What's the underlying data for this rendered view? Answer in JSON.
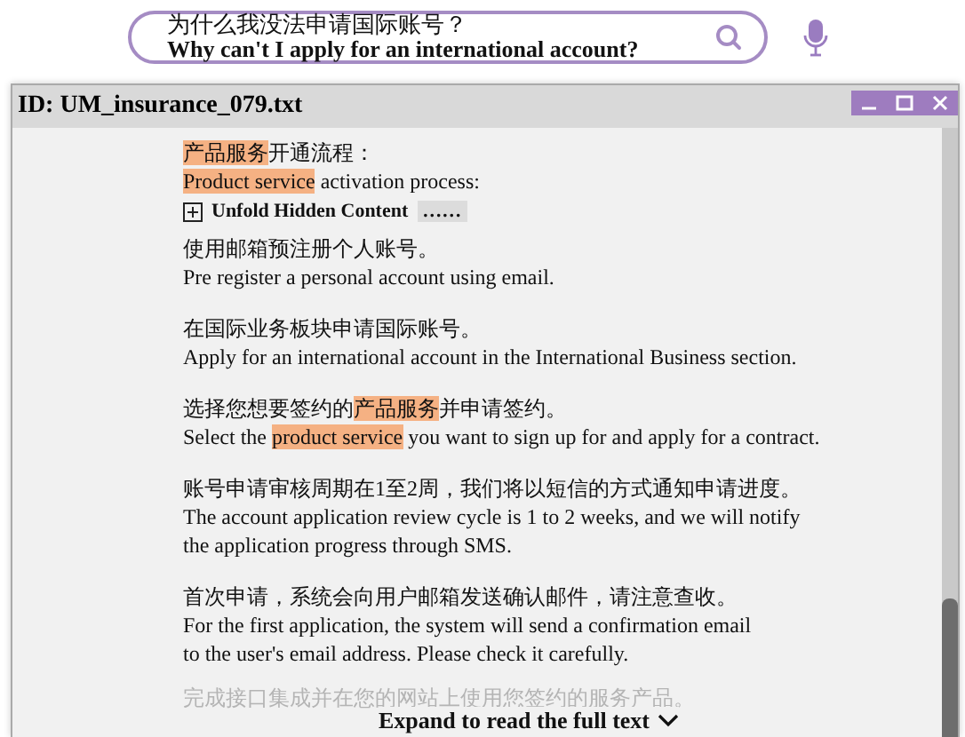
{
  "search": {
    "lines": [
      "为什么我没法申请国际账号？",
      "Why can't I apply for an international account?"
    ]
  },
  "window": {
    "title": "ID: UM_insurance_079.txt"
  },
  "heading": [
    [
      {
        "text": "产品服务",
        "highlighted": true
      },
      {
        "text": "开通流程：",
        "highlighted": false
      }
    ],
    [
      {
        "text": "Product service",
        "highlighted": true
      },
      {
        "text": " activation process:",
        "highlighted": false
      }
    ]
  ],
  "fold": {
    "label": "Unfold Hidden Content",
    "ellipsis": "……"
  },
  "paragraphs": [
    {
      "lines": [
        [
          {
            "text": "使用邮箱预注册个人账号。",
            "highlighted": false
          }
        ],
        [
          {
            "text": "Pre register a personal account using email.",
            "highlighted": false
          }
        ]
      ]
    },
    {
      "lines": [
        [
          {
            "text": "在国际业务板块申请国际账号。",
            "highlighted": false
          }
        ],
        [
          {
            "text": "Apply for an international account in the International Business section.",
            "highlighted": false
          }
        ]
      ]
    },
    {
      "lines": [
        [
          {
            "text": "选择您想要签约的",
            "highlighted": false
          },
          {
            "text": "产品服务",
            "highlighted": true
          },
          {
            "text": "并申请签约。",
            "highlighted": false
          }
        ],
        [
          {
            "text": "Select the ",
            "highlighted": false
          },
          {
            "text": "product service",
            "highlighted": true
          },
          {
            "text": " you want to sign up for and apply for a contract.",
            "highlighted": false
          }
        ]
      ]
    },
    {
      "lines": [
        [
          {
            "text": "账号申请审核周期在1至2周，我们将以短信的方式通知申请进度。",
            "highlighted": false
          }
        ],
        [
          {
            "text": "The account application review cycle is 1 to 2 weeks, and we will notify",
            "highlighted": false
          }
        ],
        [
          {
            "text": "the application progress through SMS.",
            "highlighted": false
          }
        ]
      ]
    },
    {
      "lines": [
        [
          {
            "text": "首次申请，系统会向用户邮箱发送确认邮件，请注意查收。",
            "highlighted": false
          }
        ],
        [
          {
            "text": "For the first application, the system will send a confirmation email",
            "highlighted": false
          }
        ],
        [
          {
            "text": "to the user's email address. Please check it carefully.",
            "highlighted": false
          }
        ]
      ]
    }
  ],
  "faded_line": "完成接口集成并在您的网站上使用您签约的服务产品。",
  "expand": {
    "label": "Expand to read the full text"
  }
}
